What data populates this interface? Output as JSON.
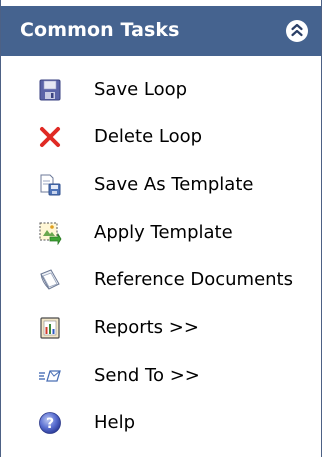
{
  "panel": {
    "title": "Common Tasks",
    "collapse_icon": "double-chevron-up-icon",
    "colors": {
      "header_bg": "#45638f",
      "header_text": "#ffffff",
      "border": "#4d6185"
    }
  },
  "tasks": [
    {
      "label": "Save Loop",
      "icon": "save-floppy-icon"
    },
    {
      "label": "Delete Loop",
      "icon": "delete-x-icon"
    },
    {
      "label": "Save As Template",
      "icon": "save-as-template-icon"
    },
    {
      "label": "Apply Template",
      "icon": "apply-template-icon"
    },
    {
      "label": "Reference Documents",
      "icon": "reference-documents-icon"
    },
    {
      "label": "Reports >>",
      "icon": "reports-icon"
    },
    {
      "label": "Send To >>",
      "icon": "send-to-icon"
    },
    {
      "label": "Help",
      "icon": "help-icon"
    }
  ]
}
